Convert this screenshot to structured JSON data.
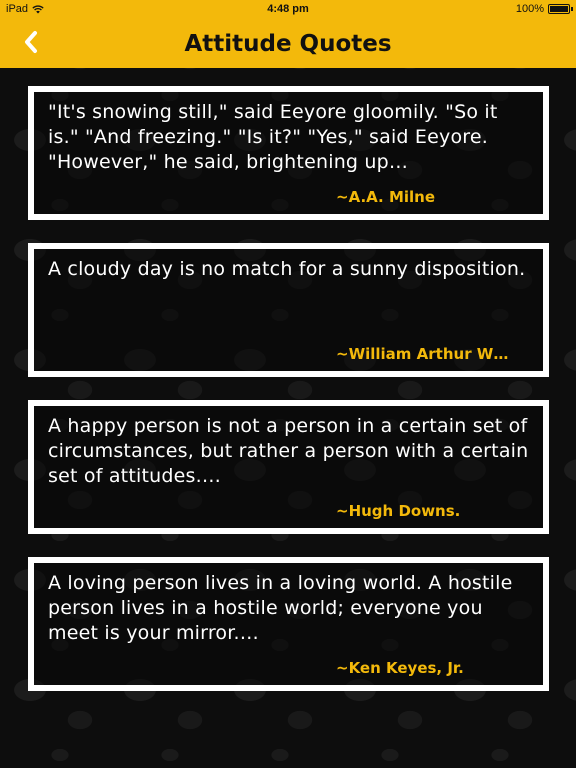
{
  "status_bar": {
    "device": "iPad",
    "time": "4:48 pm",
    "battery": "100%"
  },
  "header": {
    "title": "Attitude Quotes",
    "back_icon": "chevron-left-icon"
  },
  "colors": {
    "accent": "#f3b90b",
    "background": "#0d0d0d",
    "card_border": "#ffffff",
    "quote_text": "#ffffff",
    "author_text": "#f3b90b"
  },
  "quotes": [
    {
      "text": "\"It's snowing still,\" said Eeyore gloomily. \"So it is.\" \"And freezing.\" \"Is it?\" \"Yes,\" said Eeyore. \"However,\" he said, brightening up…",
      "author": "~A.A. Milne"
    },
    {
      "text": "A cloudy day is no match for a sunny disposition.",
      "author": "~William Arthur W…"
    },
    {
      "text": "A happy person is not a person in a certain set of circumstances, but rather a person with a certain set of attitudes.…",
      "author": "~Hugh Downs."
    },
    {
      "text": "A loving person lives in a loving world. A hostile person lives in a hostile world; everyone you meet is your mirror.…",
      "author": "~Ken Keyes, Jr."
    }
  ]
}
